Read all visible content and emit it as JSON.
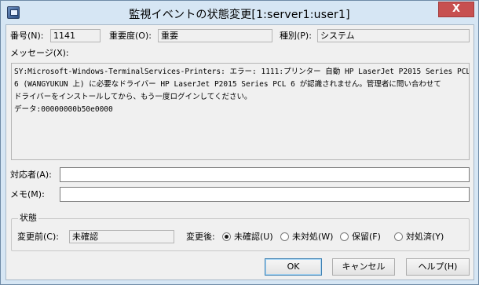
{
  "window": {
    "title": "監視イベントの状態変更[1:server1:user1]",
    "close_glyph": "X"
  },
  "fields": {
    "number_label": "番号(N):",
    "number_value": "1141",
    "importance_label": "重要度(O):",
    "importance_value": "重要",
    "type_label": "種別(P):",
    "type_value": "システム"
  },
  "message": {
    "label": "メッセージ(X):",
    "lines": [
      "SY:Microsoft-Windows-TerminalServices-Printers: エラー: 1111:プリンター 自動 HP LaserJet P2015 Series PCL",
      "6 (WANGYUKUN 上) に必要なドライバー HP LaserJet P2015 Series PCL 6 が認識されません。管理者に問い合わせて",
      "ドライバーをインストールしてから、もう一度ログインしてください。",
      "データ:00000000b50e0000"
    ]
  },
  "assignee": {
    "label": "対応者(A):",
    "value": ""
  },
  "memo": {
    "label": "メモ(M):",
    "value": ""
  },
  "status": {
    "group_title": "状態",
    "before_label": "変更前(C):",
    "before_value": "未確認",
    "after_label": "変更後:",
    "options": [
      {
        "label": "未確認(U)",
        "selected": true
      },
      {
        "label": "未対処(W)",
        "selected": false
      },
      {
        "label": "保留(F)",
        "selected": false
      },
      {
        "label": "対処済(Y)",
        "selected": false
      }
    ]
  },
  "buttons": {
    "ok": "OK",
    "cancel": "キャンセル",
    "help": "ヘルプ(H)"
  },
  "colors": {
    "titlebar": "#d6e6f4",
    "close_button": "#c75050",
    "client_background": "#f0f0f0"
  }
}
